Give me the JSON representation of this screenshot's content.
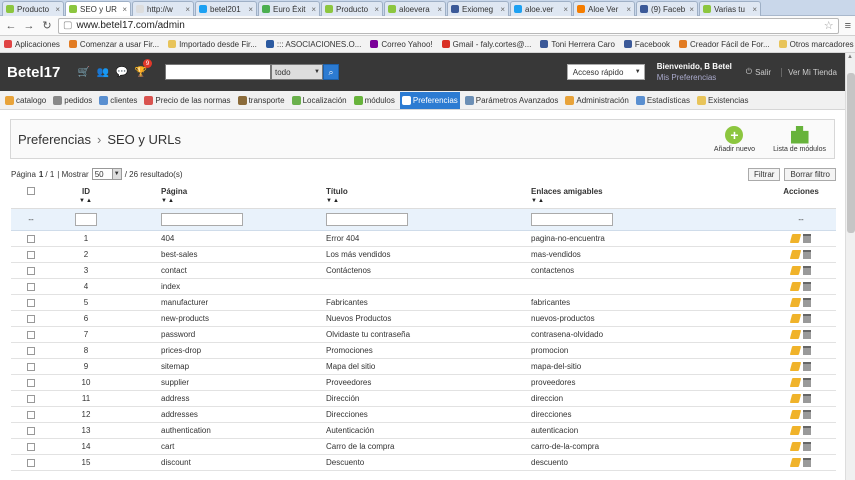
{
  "browser": {
    "tabs": [
      {
        "label": "Producto",
        "color": "#8cc63f",
        "active": false
      },
      {
        "label": "SEO y UR",
        "color": "#8cc63f",
        "active": true
      },
      {
        "label": "http://w",
        "color": "#ddd",
        "active": false
      },
      {
        "label": "betel201",
        "color": "#1da1f2",
        "active": false
      },
      {
        "label": "Euro Éxit",
        "color": "#4caf50",
        "active": false
      },
      {
        "label": "Producto",
        "color": "#8cc63f",
        "active": false
      },
      {
        "label": "aloevera",
        "color": "#8cc63f",
        "active": false
      },
      {
        "label": "Exiomeg",
        "color": "#3b5998",
        "active": false
      },
      {
        "label": "aloe.ver",
        "color": "#1da1f2",
        "active": false
      },
      {
        "label": "Aloe Ver",
        "color": "#f57d00",
        "active": false
      },
      {
        "label": "(9) Faceb",
        "color": "#3b5998",
        "active": false
      },
      {
        "label": "Varias tu",
        "color": "#8cc63f",
        "active": false
      }
    ],
    "url_main": "www.betel17.com/admin",
    "url_rest": "",
    "bookmarks": [
      {
        "label": "Aplicaciones",
        "color": "#e04444"
      },
      {
        "label": "Comenzar a usar Fir...",
        "color": "#e27b22"
      },
      {
        "label": "Importado desde Fir...",
        "color": "#e8c45a"
      },
      {
        "label": "::: ASOCIACIONES.O...",
        "color": "#2c5aa0"
      },
      {
        "label": "Correo Yahoo!",
        "color": "#7b0099"
      },
      {
        "label": "Gmail - faly.cortes@...",
        "color": "#d93025"
      },
      {
        "label": "Toni Herrera Caro",
        "color": "#3b5998"
      },
      {
        "label": "Facebook",
        "color": "#3b5998"
      },
      {
        "label": "Creador Fácil de For...",
        "color": "#e27b22"
      }
    ],
    "bookmarks_other": "Otros marcadores"
  },
  "header": {
    "logo": "Betel17",
    "notif_count": "9",
    "search_scope": "todo",
    "quick_access": "Acceso rápido",
    "welcome": "Bienvenido, B Betel",
    "preferences_link": "Mis Preferencias",
    "logout": "Salir",
    "view_store": "Ver Mi Tienda"
  },
  "nav": [
    {
      "label": "catalogo",
      "color": "#e8a33a",
      "active": false
    },
    {
      "label": "pedidos",
      "color": "#888",
      "active": false
    },
    {
      "label": "clientes",
      "color": "#5a8fd0",
      "active": false
    },
    {
      "label": "Precio de las normas",
      "color": "#d9534f",
      "active": false
    },
    {
      "label": "transporte",
      "color": "#8b6b3a",
      "active": false
    },
    {
      "label": "Localización",
      "color": "#6ab04c",
      "active": false
    },
    {
      "label": "módulos",
      "color": "#67b33b",
      "active": false
    },
    {
      "label": "Preferencias",
      "color": "#ffffff",
      "active": true
    },
    {
      "label": "Parámetros Avanzados",
      "color": "#6c8fb5",
      "active": false
    },
    {
      "label": "Administración",
      "color": "#e8a33a",
      "active": false
    },
    {
      "label": "Estadísticas",
      "color": "#5a8fd0",
      "active": false
    },
    {
      "label": "Existencias",
      "color": "#e8c45a",
      "active": false
    }
  ],
  "toolbar": {
    "crumb_parent": "Preferencias",
    "crumb_sep": "›",
    "crumb_current": "SEO y URLs",
    "add_new": "Añadir nuevo",
    "modules_list": "Lista de módulos"
  },
  "pager": {
    "page_label": "Página",
    "page_current": "1",
    "page_total": "/ 1",
    "show_label": "| Mostrar",
    "per_page": "50",
    "result_count": "/ 26 resultado(s)",
    "filter": "Filtrar",
    "reset_filter": "Borrar filtro"
  },
  "table": {
    "headers": {
      "id": "ID",
      "page": "Página",
      "title": "Título",
      "friendly": "Enlaces amigables",
      "actions": "Acciones"
    },
    "filter_dash": "--",
    "rows": [
      {
        "id": "1",
        "page": "404",
        "title": "Error 404",
        "friendly": "pagina-no-encuentra"
      },
      {
        "id": "2",
        "page": "best-sales",
        "title": "Los más vendidos",
        "friendly": "mas-vendidos"
      },
      {
        "id": "3",
        "page": "contact",
        "title": "Contáctenos",
        "friendly": "contactenos"
      },
      {
        "id": "4",
        "page": "index",
        "title": "",
        "friendly": ""
      },
      {
        "id": "5",
        "page": "manufacturer",
        "title": "Fabricantes",
        "friendly": "fabricantes"
      },
      {
        "id": "6",
        "page": "new-products",
        "title": "Nuevos Productos",
        "friendly": "nuevos-productos"
      },
      {
        "id": "7",
        "page": "password",
        "title": "Olvidaste tu contraseña",
        "friendly": "contrasena-olvidado"
      },
      {
        "id": "8",
        "page": "prices-drop",
        "title": "Promociones",
        "friendly": "promocion"
      },
      {
        "id": "9",
        "page": "sitemap",
        "title": "Mapa del sitio",
        "friendly": "mapa-del-sitio"
      },
      {
        "id": "10",
        "page": "supplier",
        "title": "Proveedores",
        "friendly": "proveedores"
      },
      {
        "id": "11",
        "page": "address",
        "title": "Dirección",
        "friendly": "direccion"
      },
      {
        "id": "12",
        "page": "addresses",
        "title": "Direcciones",
        "friendly": "direcciones"
      },
      {
        "id": "13",
        "page": "authentication",
        "title": "Autenticación",
        "friendly": "autenticacion"
      },
      {
        "id": "14",
        "page": "cart",
        "title": "Carro de la compra",
        "friendly": "carro-de-la-compra"
      },
      {
        "id": "15",
        "page": "discount",
        "title": "Descuento",
        "friendly": "descuento"
      }
    ]
  }
}
